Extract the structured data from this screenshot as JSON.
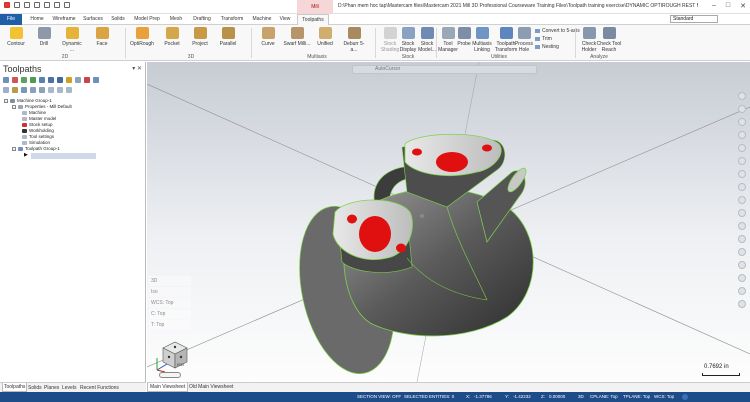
{
  "window": {
    "title": "D:\\Phan mem hoc tap\\Mastercam files\\Mastercam 2021 Mill 3D Professional Courseware Training Files\\Toolpath training exercise\\DYNAMIC OPTIROUGH REST MATERIAL STL.mcam - M...",
    "context_tab": "Mill",
    "standard": "Standard"
  },
  "tabs": [
    "File",
    "Home",
    "Wireframe",
    "Surfaces",
    "Solids",
    "Model Prep",
    "Mesh",
    "Drafting",
    "Transform",
    "Machine",
    "View",
    "Toolpaths"
  ],
  "ribbon": {
    "g2d": [
      "Contour",
      "Drill",
      "Dynamic ...",
      "Face"
    ],
    "g3d": [
      "OptiRough",
      "Pocket",
      "Project",
      "Parallel"
    ],
    "gmultiaxis": [
      "Curve",
      "Swarf Milli...",
      "Unified",
      "Deburr 5-a..."
    ],
    "gstock": [
      "Stock Shading",
      "Stock Display",
      "Stock Model..."
    ],
    "gutilities": [
      "Tool Manager",
      "Probe",
      "Multiaxis Linking",
      "Toolpath Transform",
      "Process Hole"
    ],
    "gutil_small": [
      "Convert to 5-axis",
      "Trim",
      "Nesting"
    ],
    "ganalyze": [
      "Check Holder",
      "Check Tool Reach"
    ],
    "groups": [
      "2D",
      "3D",
      "Multiaxis",
      "Stock",
      "Utilities",
      "Analyze"
    ]
  },
  "panel": {
    "title": "Toolpaths",
    "tree": [
      "Machine Group-1",
      "Properties - Mill Default",
      "Machine",
      "Master model",
      "Stock setup",
      "Workholding",
      "Tool settings",
      "Simulation",
      "Toolpath Group-1"
    ],
    "bottom_tabs": [
      "Toolpaths",
      "Solids",
      "Planes",
      "Levels",
      "Recent Functions"
    ]
  },
  "viewport": {
    "toolbar": "AutoCursor",
    "planes": [
      "3D",
      "Iso",
      "WCS: Top",
      "C: Top",
      "T: Top"
    ],
    "scale": "0.7692 in",
    "tabs": [
      "Main Viewsheet",
      "Old Main Viewsheet"
    ],
    "cube_label": "ISO"
  },
  "status": {
    "section_view": "SECTION VIEW: OFF",
    "selected": "SELECTED ENTITIES: 0",
    "x": "X:",
    "x_val": "-1.37786",
    "y": "Y:",
    "y_val": "-1.42232",
    "z": "Z:",
    "z_val": "0.00000",
    "mode": "3D",
    "cplane": "CPLANE: Top",
    "tplane": "TPLANE: Top",
    "wcs": "WCS: Top"
  },
  "colors": {
    "file_tab": "#1e5fa8",
    "status_bar": "#1e4c88",
    "part_highlight": "#e01010",
    "edge_green": "#7fd44a"
  }
}
